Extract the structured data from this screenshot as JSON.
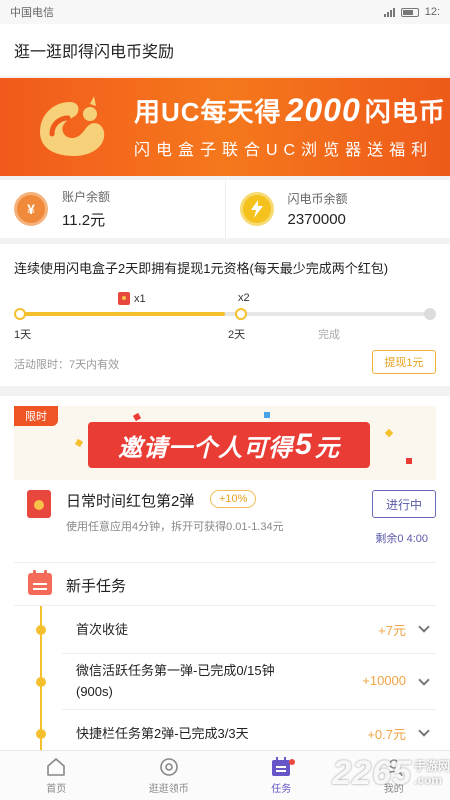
{
  "status_bar": {
    "carrier": "中国电信",
    "time": "12:"
  },
  "header": {
    "title": "逛一逛即得闪电币奖励"
  },
  "banner": {
    "line1_prefix": "用UC每天得",
    "line1_number": "2000",
    "line1_suffix": "闪电币",
    "line2": "闪电盒子联合UC浏览器送福利"
  },
  "balances": {
    "account": {
      "label": "账户余额",
      "value": "11.2元",
      "icon": "yuan-coin-icon"
    },
    "flash": {
      "label": "闪电币余额",
      "value": "2370000",
      "icon": "lightning-coin-icon"
    }
  },
  "checkin": {
    "title": "连续使用闪电盒子2天即拥有提现1元资格(每天最少完成两个红包)",
    "progress": 0.5,
    "marker_x1": "x1",
    "marker_x2": "x2",
    "days": [
      "1天",
      "2天",
      "完成"
    ],
    "limit_text": "活动限时：7天内有效",
    "withdraw_label": "提现1元"
  },
  "promo": {
    "tag": "限时",
    "text_prefix": "邀请一个人可得",
    "text_number": "5",
    "text_suffix": "元"
  },
  "red_packet_task": {
    "title": "日常时间红包第2弹",
    "badge": "+10%",
    "desc": "使用任意应用4分钟，拆开可获得0.01-1.34元",
    "button_label": "进行中",
    "remain": "剩余0 4:00"
  },
  "newbie": {
    "title": "新手任务",
    "tasks": [
      {
        "text": "首次收徒",
        "reward": "+7元"
      },
      {
        "text": "微信活跃任务第一弹-已完成0/15钟(900s)",
        "reward": "+10000"
      },
      {
        "text": "快捷栏任务第2弹-已完成3/3天",
        "reward": "+0.7元"
      }
    ]
  },
  "tabbar": {
    "items": [
      {
        "label": "首页",
        "icon": "home-icon"
      },
      {
        "label": "逛逛领币",
        "icon": "eye-icon"
      },
      {
        "label": "任务",
        "icon": "calendar-icon"
      },
      {
        "label": "我的",
        "icon": "user-icon"
      }
    ],
    "active_index": 2
  },
  "watermark": {
    "number": "2265",
    "line1": "手游网",
    "line2": ".com"
  },
  "colors": {
    "banner_orange": "#f25a1b",
    "progress_yellow": "#f5c02d",
    "accent_purple": "#6456c7",
    "reward_orange": "#f0a442",
    "red_packet": "#e8473e"
  }
}
